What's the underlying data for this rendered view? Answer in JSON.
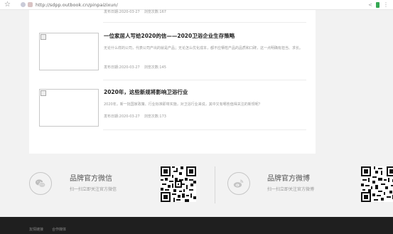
{
  "browser": {
    "url": "http://sdpp.outbook.cn/pinpaizixun/"
  },
  "articles": [
    {
      "title": "",
      "summary": "",
      "date_label": "发布日期:2020-03-27",
      "views_label": "浏览次数:167"
    },
    {
      "title": "一位家居人写给2020的信——2020卫浴企业生存策略",
      "summary": "无论什么样的公司，代表公司产出的就是产品；无论怎么优化成本，都不应牺牲产品的品质和口碑，这一点明确有担当、求长。",
      "date_label": "发布日期:2020-03-27",
      "views_label": "浏览次数:145"
    },
    {
      "title": "2020年，这些新规将影响卫浴行业",
      "summary": "2020年，新一批国家政策、行业标准即将实施，对卫浴行业来说，其中又有哪些值得关注的新规呢？",
      "date_label": "发布日期:2020-03-27",
      "views_label": "浏览次数:173"
    }
  ],
  "brand": {
    "wechat": {
      "title": "品牌官方微信",
      "subtitle": "扫一扫立即关注官方微信",
      "icon": "wechat-icon"
    },
    "weibo": {
      "title": "品牌官方微博",
      "subtitle": "扫一扫立即关注官方微博",
      "icon": "weibo-icon"
    }
  },
  "footer": {
    "links": [
      "友情链接",
      "合作媒体"
    ]
  },
  "colors": {
    "page_bg": "#f2f2f2",
    "footer_bg": "#1f1f1f"
  }
}
